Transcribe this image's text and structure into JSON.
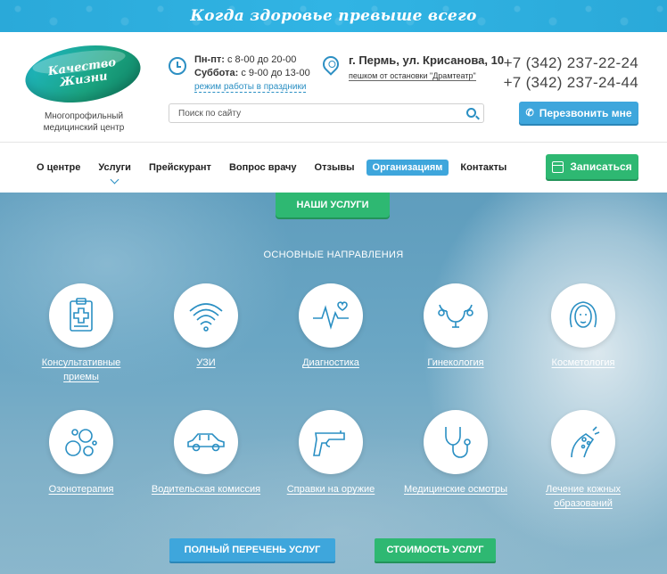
{
  "topbar": {
    "slogan": "Когда здоровье превыше всего"
  },
  "logo": {
    "line1": "Качество",
    "line2": "Жизни",
    "subtitle_line1": "Многопрофильный",
    "subtitle_line2": "медицинский центр"
  },
  "hours": {
    "weekdays_label": "Пн-пт:",
    "weekdays_value": "с 8-00 до 20-00",
    "saturday_label": "Суббота:",
    "saturday_value": "с 9-00 до 13-00",
    "holidays_link": "режим работы в праздники"
  },
  "address": {
    "main": "г. Пермь, ул. Крисанова, 10",
    "sub": "пешком от остановки \"Драмтеатр\""
  },
  "phones": [
    "+7 (342) 237-22-24",
    "+7 (342) 237-24-44"
  ],
  "search": {
    "placeholder": "Поиск по сайту"
  },
  "callback": {
    "label": "Перезвонить мне"
  },
  "nav": {
    "items": [
      {
        "label": "О центре"
      },
      {
        "label": "Услуги"
      },
      {
        "label": "Прейскурант"
      },
      {
        "label": "Вопрос врачу"
      },
      {
        "label": "Отзывы"
      },
      {
        "label": "Организациям"
      },
      {
        "label": "Контакты"
      }
    ],
    "signup": "Записаться"
  },
  "hero": {
    "tab": "НАШИ УСЛУГИ",
    "heading": "ОСНОВНЫЕ НАПРАВЛЕНИЯ",
    "services": [
      {
        "label": "Консультативные приемы",
        "icon": "clipboard-medical-icon"
      },
      {
        "label": "УЗИ",
        "icon": "ultrasound-waves-icon"
      },
      {
        "label": "Диагностика",
        "icon": "heartbeat-icon"
      },
      {
        "label": "Гинекология",
        "icon": "uterus-icon"
      },
      {
        "label": "Косметология",
        "icon": "woman-face-icon"
      },
      {
        "label": "Озонотерапия",
        "icon": "ozone-bubbles-icon"
      },
      {
        "label": "Водительская комиссия",
        "icon": "car-icon"
      },
      {
        "label": "Справки на оружие",
        "icon": "pistol-icon"
      },
      {
        "label": "Медицинские осмотры",
        "icon": "stethoscope-icon"
      },
      {
        "label": "Лечение кожных образований",
        "icon": "skin-mole-icon"
      }
    ],
    "btn_list": "ПОЛНЫЙ ПЕРЕЧЕНЬ УСЛУГ",
    "btn_price": "СТОИМОСТЬ УСЛУГ"
  },
  "colors": {
    "brand_blue": "#3ea6dc",
    "brand_green": "#2eb872",
    "icon_blue": "#2a8fc3"
  }
}
